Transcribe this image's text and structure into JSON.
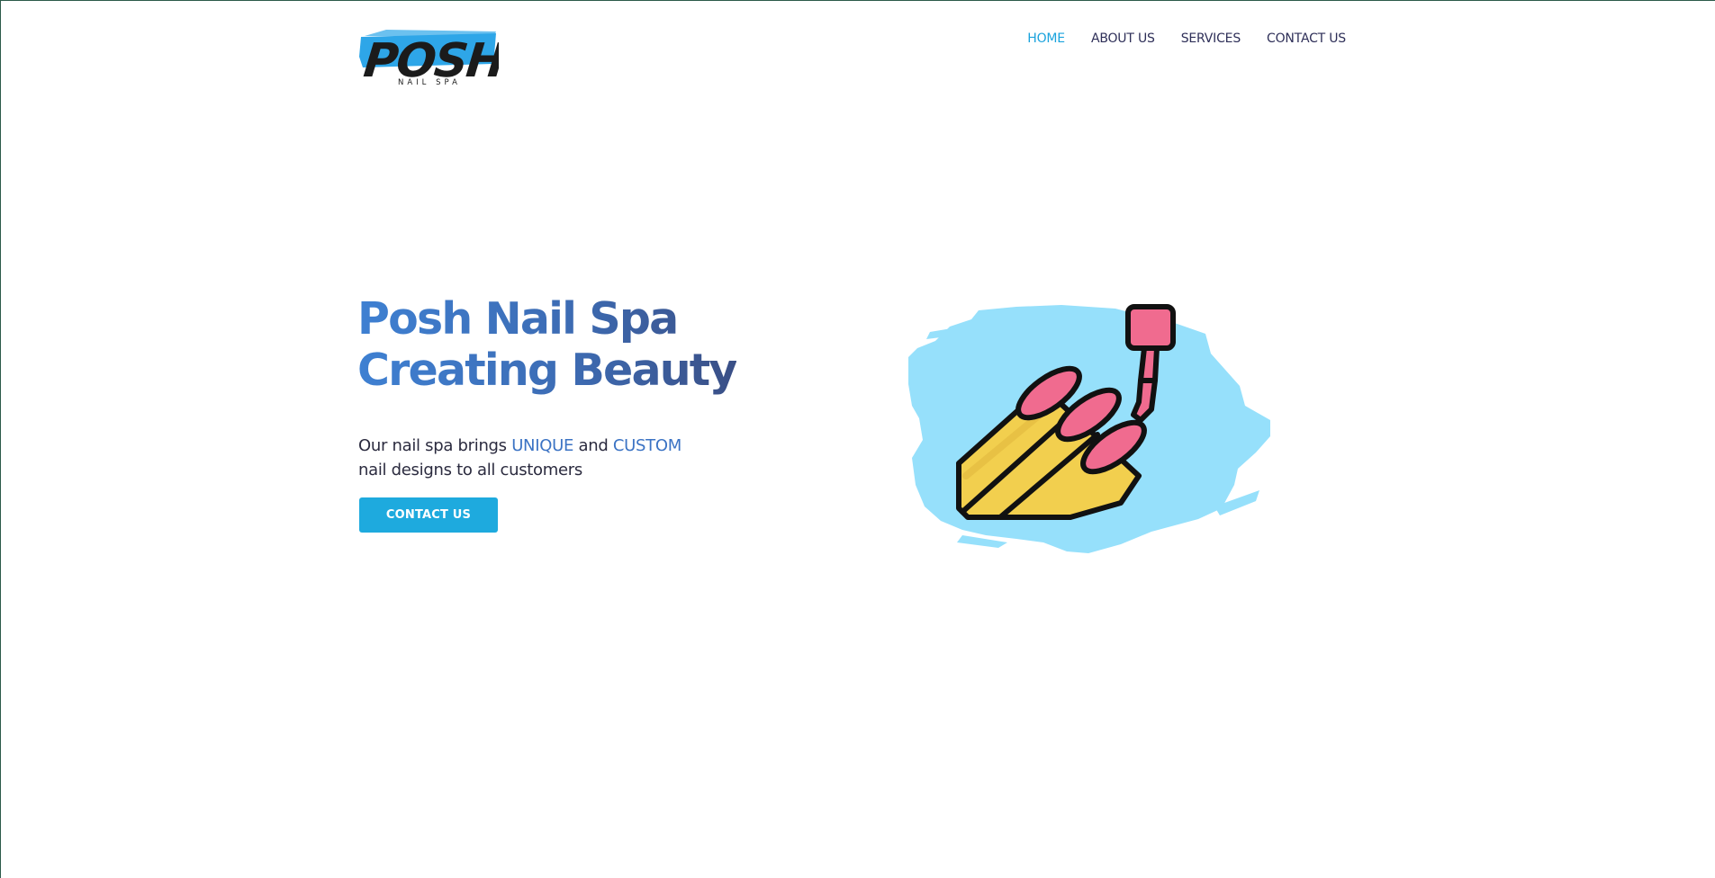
{
  "header": {
    "logo": {
      "wordmark": "POSH",
      "tagline": "NAIL SPA"
    },
    "nav": [
      {
        "label": "HOME",
        "active": true
      },
      {
        "label": "ABOUT US",
        "active": false
      },
      {
        "label": "SERVICES",
        "active": false
      },
      {
        "label": "CONTACT US",
        "active": false
      }
    ]
  },
  "hero": {
    "title_line1": "Posh Nail Spa",
    "title_line2": "Creating Beauty",
    "description": {
      "part1": "Our nail spa brings ",
      "highlight1": "UNIQUE",
      "part2": " and ",
      "highlight2": "CUSTOM",
      "part3": "nail designs to all customers"
    },
    "cta_label": "CONTACT US",
    "illustration": "nail-polish-illustration"
  },
  "colors": {
    "accent": "#1eaade",
    "nav_active": "#1aa3dd",
    "nav_text": "#2e2f58",
    "title_gradient_start": "#3e80d2",
    "title_gradient_end": "#3a4f86",
    "brush_blue": "#96e0fb",
    "nail_pink": "#f06b8f",
    "finger_yellow": "#f2cf4e"
  }
}
